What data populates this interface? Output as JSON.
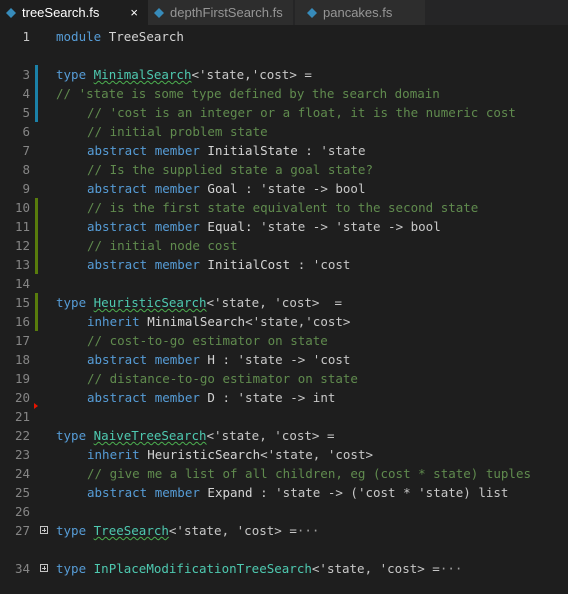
{
  "tabs": [
    {
      "label": "treeSearch.fs",
      "close": "×"
    },
    {
      "label": "depthFirstSearch.fs"
    },
    {
      "label": "pancakes.fs"
    }
  ],
  "editor": {
    "line_numbers": [
      "1",
      "3",
      "4",
      "5",
      "6",
      "7",
      "8",
      "9",
      "10",
      "11",
      "12",
      "13",
      "14",
      "15",
      "16",
      "17",
      "18",
      "19",
      "20",
      "21",
      "22",
      "23",
      "24",
      "25",
      "26",
      "27",
      "34"
    ],
    "lines": {
      "l1": {
        "kw": "module",
        "name": "TreeSearch"
      },
      "l3": {
        "kw": "type",
        "name": "MinimalSearch",
        "params": "<'state,'cost> ="
      },
      "l4": {
        "text": "// 'state is some type defined by the search domain"
      },
      "l5": {
        "text": "// 'cost is an integer or a float, it is the numeric cost"
      },
      "l6": {
        "text": "// initial problem state"
      },
      "l7": {
        "kw": "abstract member",
        "member": "InitialState",
        "sig": ": 'state"
      },
      "l8": {
        "text": "// Is the supplied state a goal state?"
      },
      "l9": {
        "kw": "abstract member",
        "member": "Goal",
        "sig": ": 'state -> bool"
      },
      "l10": {
        "text": "// is the first state equivalent to the second state"
      },
      "l11": {
        "kw": "abstract member",
        "member": "Equal:",
        "sig": "'state -> 'state -> bool"
      },
      "l12": {
        "text": "// initial node cost"
      },
      "l13": {
        "kw": "abstract member",
        "member": "InitialCost",
        "sig": ": 'cost"
      },
      "l15": {
        "kw": "type",
        "name": "HeuristicSearch",
        "params": "<'state, 'cost>  ="
      },
      "l16": {
        "kw": "inherit",
        "name": "MinimalSearch",
        "params": "<'state,'cost>"
      },
      "l17": {
        "text": "// cost-to-go estimator on state"
      },
      "l18": {
        "kw": "abstract member",
        "member": "H",
        "sig": ": 'state -> 'cost"
      },
      "l19": {
        "text": "// distance-to-go estimator on state"
      },
      "l20": {
        "kw": "abstract member",
        "member": "D",
        "sig": ": 'state -> int"
      },
      "l22": {
        "kw": "type",
        "name": "NaiveTreeSearch",
        "params": "<'state, 'cost> ="
      },
      "l23": {
        "kw": "inherit",
        "name": "HeuristicSearch",
        "params": "<'state, 'cost>"
      },
      "l24": {
        "text": "// give me a list of all children, eg (cost * state) tuples"
      },
      "l25": {
        "kw": "abstract member",
        "member": "Expand",
        "sig": ": 'state -> ('cost * 'state) list"
      },
      "l27": {
        "kw": "type",
        "name": "TreeSearch",
        "params": "<'state, 'cost> =",
        "ellipsis": "···"
      },
      "l34": {
        "kw": "type",
        "name": "InPlaceModificationTreeSearch",
        "params": "<'state, 'cost> =",
        "ellipsis": "···"
      }
    }
  },
  "colors": {
    "background": "#1e1e1e",
    "keyword": "#569cd6",
    "type": "#4ec9b0",
    "comment": "#608b4e",
    "modified_gutter": "#1b81a8",
    "added_gutter": "#587c0c",
    "error_marker": "#e51400"
  },
  "icons": [
    "fsharp-file-icon",
    "close-icon",
    "fold-expand-icon"
  ]
}
